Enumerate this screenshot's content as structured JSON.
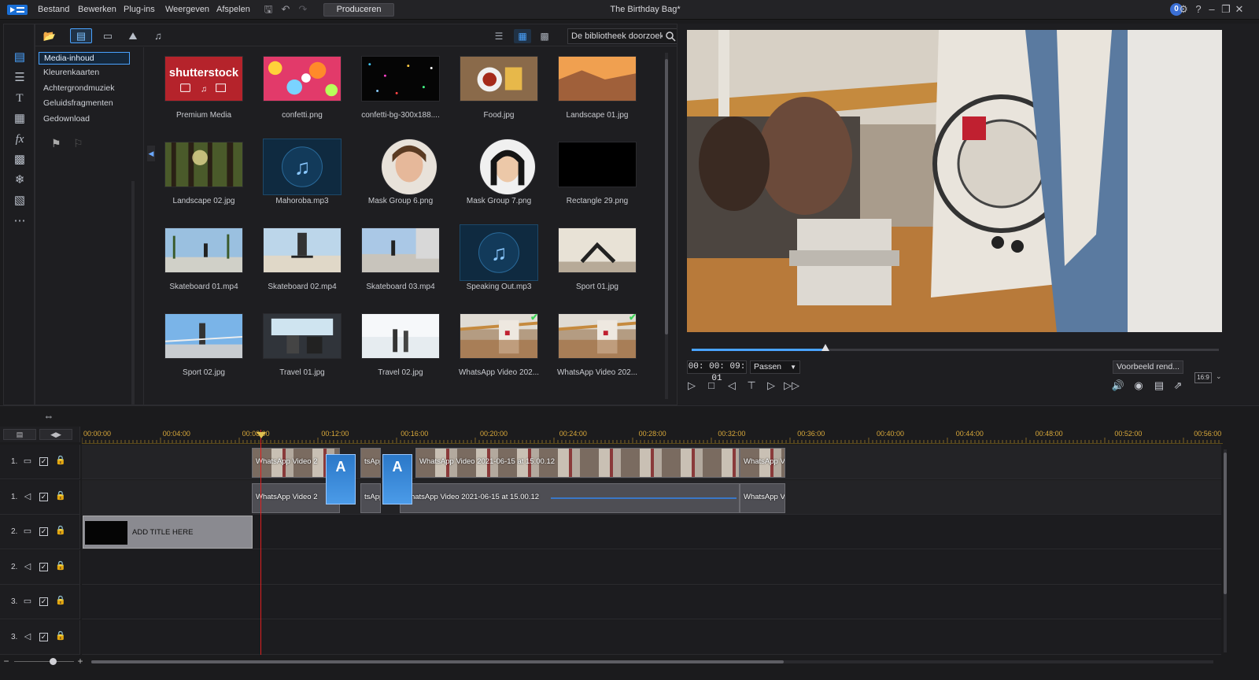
{
  "menubar": {
    "items": [
      "Bestand",
      "Bewerken",
      "Plug-ins",
      "Weergeven",
      "Afspelen"
    ],
    "produce_label": "Produceren",
    "project_title": "The Birthday Bag*",
    "user_initial": "0"
  },
  "library": {
    "search_placeholder": "De bibliotheek doorzoek...",
    "tree": [
      "Media-inhoud",
      "Kleurenkaarten",
      "Achtergrondmuziek",
      "Geluidsfragmenten",
      "Gedownload"
    ],
    "active_tree_index": 0,
    "items": [
      {
        "label": "Premium Media",
        "kind": "shutterstock",
        "checked": false
      },
      {
        "label": "confetti.png",
        "kind": "confetti",
        "checked": false
      },
      {
        "label": "confetti-bg-300x188....",
        "kind": "confetti-dark",
        "checked": false
      },
      {
        "label": "Food.jpg",
        "kind": "food",
        "checked": false
      },
      {
        "label": "Landscape 01.jpg",
        "kind": "canyon",
        "checked": false
      },
      {
        "label": "Landscape 02.jpg",
        "kind": "forest",
        "checked": false
      },
      {
        "label": "Mahoroba.mp3",
        "kind": "music",
        "checked": false
      },
      {
        "label": "Mask Group 6.png",
        "kind": "portrait-1",
        "checked": false
      },
      {
        "label": "Mask Group 7.png",
        "kind": "portrait-2",
        "checked": false
      },
      {
        "label": "Rectangle 29.png",
        "kind": "black",
        "checked": false
      },
      {
        "label": "Skateboard 01.mp4",
        "kind": "skate-1",
        "checked": false
      },
      {
        "label": "Skateboard 02.mp4",
        "kind": "skate-2",
        "checked": false
      },
      {
        "label": "Skateboard 03.mp4",
        "kind": "skate-3",
        "checked": false
      },
      {
        "label": "Speaking Out.mp3",
        "kind": "music",
        "checked": false
      },
      {
        "label": "Sport 01.jpg",
        "kind": "sport-1",
        "checked": false
      },
      {
        "label": "Sport 02.jpg",
        "kind": "sport-2",
        "checked": false
      },
      {
        "label": "Travel 01.jpg",
        "kind": "travel-1",
        "checked": false
      },
      {
        "label": "Travel 02.jpg",
        "kind": "travel-2",
        "checked": false
      },
      {
        "label": "WhatsApp Video 202...",
        "kind": "whatsapp",
        "checked": true
      },
      {
        "label": "WhatsApp Video 202...",
        "kind": "whatsapp",
        "checked": true
      }
    ],
    "shutterstock_logo_text": "shutterstock"
  },
  "preview": {
    "timecode": "00: 00: 09: 01",
    "fit_label": "Passen",
    "render_label": "Voorbeeld rend...",
    "aspect_label": "16:9",
    "progress": 0.253
  },
  "timeline": {
    "ruler": [
      "00:00:00",
      "00:04:00",
      "00:08:00",
      "00:12:00",
      "00:16:00",
      "00:20:00",
      "00:24:00",
      "00:28:00",
      "00:32:00",
      "00:36:00",
      "00:40:00",
      "00:44:00",
      "00:48:00",
      "00:52:00",
      "00:56:00"
    ],
    "tracks": [
      {
        "num": "1.",
        "type": "video"
      },
      {
        "num": "1.",
        "type": "audio"
      },
      {
        "num": "2.",
        "type": "video"
      },
      {
        "num": "2.",
        "type": "audio"
      },
      {
        "num": "3.",
        "type": "video"
      },
      {
        "num": "3.",
        "type": "audio"
      }
    ],
    "clip_labels": {
      "v1a": "WhatsApp Video 2",
      "v1b": "tsApp",
      "v1c": "WhatsApp Video 2021-06-15 at 15.00.12",
      "v1d": "WhatsApp V",
      "a1a": "WhatsApp Video 2",
      "a1b": "tsApp",
      "a1c": "WhatsApp Video 2021-06-15 at 15.00.12",
      "a1d": "WhatsApp V",
      "title": "ADD TITLE HERE",
      "transition": "A"
    },
    "zoom": 0.65
  },
  "colors": {
    "accent": "#4aa3ff",
    "playhead": "#e02020",
    "ruler_text": "#d8a83a",
    "checked": "#3ed45b"
  }
}
